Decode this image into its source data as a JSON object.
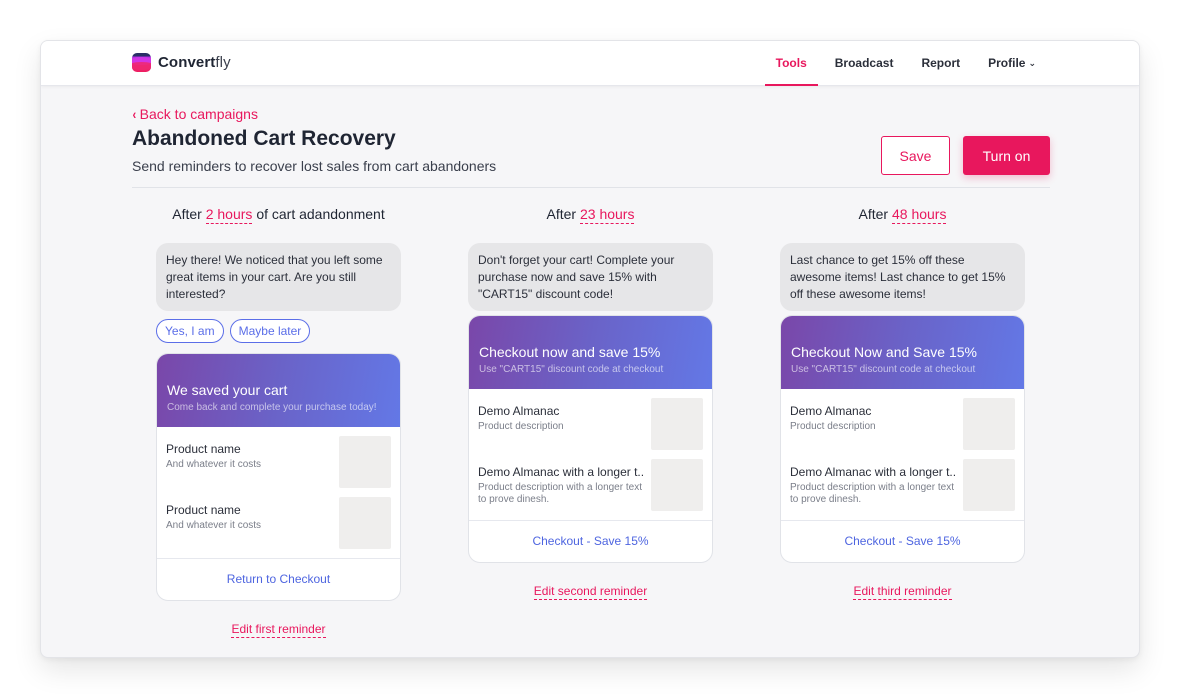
{
  "app": {
    "brand_bold": "Convert",
    "brand_light": "fly",
    "nav": [
      {
        "label": "Tools",
        "active": true
      },
      {
        "label": "Broadcast",
        "active": false
      },
      {
        "label": "Report",
        "active": false
      },
      {
        "label": "Profile",
        "active": false,
        "icon": "chevron-down-icon",
        "glyph": "⌄"
      }
    ]
  },
  "header": {
    "back_icon": "‹",
    "back_label": "Back to campaigns",
    "title": "Abandoned Cart Recovery",
    "subtitle": "Send reminders to recover lost sales from cart abandoners",
    "save_label": "Save",
    "turn_on_label": "Turn on"
  },
  "colors": {
    "accent": "#e8175d",
    "link_blue": "#4e65e0",
    "hero_gradient_start": "#7a47a9",
    "hero_gradient_end": "#6378e6"
  },
  "reminders": [
    {
      "heading_prefix": "After",
      "hours": "2 hours",
      "heading_suffix": "of cart adandonment",
      "message": "Hey there! We noticed that you left some great items in your cart. Are you still interested?",
      "quick_replies": [
        "Yes, I am",
        "Maybe later"
      ],
      "card_title": "We saved your cart",
      "card_subtitle": "Come back and complete your purchase today!",
      "products": [
        {
          "name": "Product name",
          "desc": "And whatever it costs"
        },
        {
          "name": "Product name",
          "desc": "And whatever it costs"
        }
      ],
      "cta": "Return to Checkout",
      "edit_label": "Edit first reminder"
    },
    {
      "heading_prefix": "After",
      "hours": "23 hours",
      "heading_suffix": "",
      "message": "Don't forget your cart! Complete your purchase now and save 15% with \"CART15\" discount code!",
      "card_title": "Checkout now and save 15%",
      "card_subtitle": "Use \"CART15\" discount code at checkout",
      "products": [
        {
          "name": "Demo Almanac",
          "desc": "Product description"
        },
        {
          "name": "Demo Almanac with a longer t..",
          "desc": "Product description with a longer text to prove dinesh."
        }
      ],
      "cta": "Checkout - Save 15%",
      "edit_label": "Edit second reminder"
    },
    {
      "heading_prefix": "After",
      "hours": "48 hours",
      "heading_suffix": "",
      "message": "Last chance to get 15% off these awesome items! Last chance to get 15% off these awesome items!",
      "card_title": "Checkout Now and Save 15%",
      "card_subtitle": "Use \"CART15\" discount code at checkout",
      "products": [
        {
          "name": "Demo Almanac",
          "desc": "Product description"
        },
        {
          "name": "Demo Almanac with a longer t..",
          "desc": "Product description with a longer text to prove dinesh."
        }
      ],
      "cta": "Checkout - Save 15%",
      "edit_label": "Edit third reminder"
    }
  ]
}
